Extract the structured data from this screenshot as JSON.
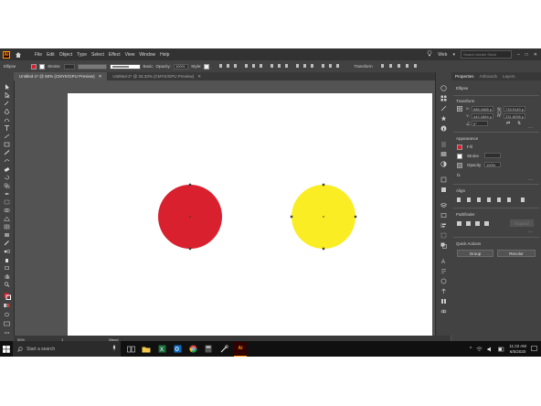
{
  "menubar": {
    "logo": "Ai",
    "items": [
      "File",
      "Edit",
      "Object",
      "Type",
      "Select",
      "Effect",
      "View",
      "Window",
      "Help"
    ],
    "workspace": "Web",
    "search_placeholder": "Search Adobe Stock"
  },
  "control": {
    "object_type": "Ellipse",
    "stroke_label": "Stroke:",
    "brush_label": "Basic",
    "opacity_label": "Opacity:",
    "opacity_value": "100%",
    "style_label": "Style:",
    "transform_label": "Transform"
  },
  "tabs": [
    {
      "label": "Untitled-1* @ 50% (CMYK/GPU Preview)"
    },
    {
      "label": "Untitled-2* @ 33.33% (CMYK/GPU Preview)"
    }
  ],
  "status": {
    "zoom": "50%",
    "page": "1",
    "tool": "Blend"
  },
  "panel": {
    "tabs": [
      "Properties",
      "Artboards",
      "Layers"
    ],
    "object_type": "Ellipse",
    "transform_title": "Transform",
    "x_label": "X:",
    "x_value": "686.4468 p",
    "y_label": "Y:",
    "y_value": "442.1664 p",
    "w_label": "W:",
    "w_value": "715.9149 p",
    "h_label": "H:",
    "h_value": "231.8298 p",
    "angle_value": "0°",
    "appearance_title": "Appearance",
    "fill_label": "Fill",
    "stroke_label": "Stroke",
    "opacity_label": "Opacity",
    "opacity_value": "100%",
    "fx_label": "fx.",
    "align_title": "Align",
    "pathfinder_title": "Pathfinder",
    "expand_label": "Expand",
    "quick_actions_title": "Quick Actions",
    "group_button": "Group",
    "recolor_button": "Recolor"
  },
  "canvas": {
    "left_circle_color": "#d9202e",
    "right_circle_color": "#faed24"
  },
  "taskbar": {
    "search_placeholder": "Start a search",
    "time": "11:22 AM",
    "date": "6/5/2020"
  },
  "colors": {
    "accent": "#ff9a00",
    "ui_bg": "#535353",
    "panel_bg": "#424242"
  }
}
